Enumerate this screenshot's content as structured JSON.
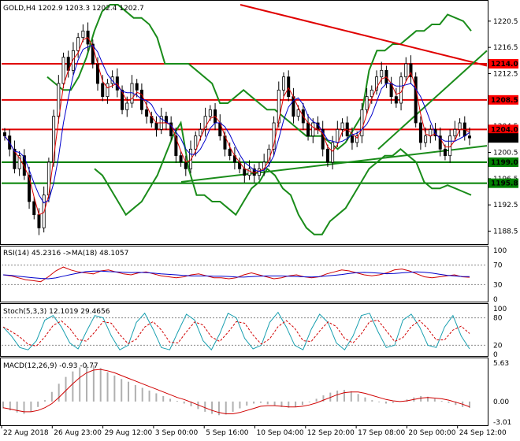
{
  "chart_data": [
    {
      "type": "candlestick",
      "title": "GOLD, H4",
      "ohlc_label": "GOLD,H4  1202.9 1203.3 1202.4 1202.7",
      "ylim": [
        1187,
        1223
      ],
      "y_ticks": [
        "1220.5",
        "1216.5",
        "1212.5",
        "1208.5",
        "1204.5",
        "1200.5",
        "1196.5",
        "1192.5",
        "1188.5"
      ],
      "x_labels": [
        "22 Aug 2018",
        "26 Aug 23:00",
        "29 Aug 12:00",
        "3 Sep 00:00",
        "5 Sep 16:00",
        "10 Sep 04:00",
        "12 Sep 20:00",
        "17 Sep 08:00",
        "20 Sep 00:00",
        "24 Sep 12:00"
      ],
      "price_tags": [
        {
          "label": "1214.0",
          "value": 1214.0,
          "color": "#ff0000"
        },
        {
          "label": "1208.5",
          "value": 1208.5,
          "color": "#ff0000"
        },
        {
          "label": "1204.0",
          "value": 1204.0,
          "color": "#ff0000"
        },
        {
          "label": "1202.7",
          "value": 1202.7,
          "color": "#000000"
        },
        {
          "label": "1199.0",
          "value": 1199.0,
          "color": "#008000"
        },
        {
          "label": "1195.8",
          "value": 1195.8,
          "color": "#008000"
        }
      ],
      "h_lines": [
        {
          "value": 1214.0,
          "color": "#e00000"
        },
        {
          "value": 1208.5,
          "color": "#e00000"
        },
        {
          "value": 1204.0,
          "color": "#e00000"
        },
        {
          "value": 1199.0,
          "color": "#008000"
        },
        {
          "value": 1195.8,
          "color": "#008000"
        }
      ],
      "close": [
        1203,
        1201,
        1198,
        1200,
        1197,
        1193,
        1191,
        1189,
        1194,
        1199,
        1206,
        1211,
        1215,
        1213,
        1216,
        1218,
        1219,
        1217,
        1214,
        1211,
        1209,
        1211,
        1212,
        1210,
        1207,
        1208,
        1211,
        1210,
        1207,
        1206,
        1205,
        1204,
        1206,
        1205,
        1203,
        1200,
        1199,
        1198,
        1201,
        1203,
        1204,
        1206,
        1207,
        1205,
        1203,
        1201,
        1200,
        1199,
        1198,
        1197,
        1198,
        1197,
        1198,
        1199,
        1201,
        1205,
        1210,
        1212,
        1209,
        1206,
        1207,
        1205,
        1203,
        1205,
        1204,
        1201,
        1199,
        1202,
        1204,
        1205,
        1203,
        1202,
        1203,
        1207,
        1209,
        1210,
        1212,
        1213,
        1211,
        1209,
        1208,
        1212,
        1214,
        1212,
        1205,
        1202,
        1203,
        1204,
        1203,
        1201,
        1200,
        1203,
        1204,
        1205,
        1203,
        1202.7
      ],
      "bb_upper": [
        1212,
        1211,
        1210,
        1210,
        1212,
        1215,
        1219,
        1222,
        1223,
        1223,
        1222,
        1221,
        1221,
        1220,
        1218,
        1214,
        1214,
        1214,
        1214,
        1213,
        1212,
        1211,
        1208,
        1208,
        1209,
        1210,
        1209,
        1208,
        1207,
        1207,
        1206,
        1205,
        1204,
        1203,
        1203,
        1203,
        1202,
        1201,
        1202,
        1204,
        1206,
        1213,
        1216,
        1216,
        1217,
        1217,
        1218,
        1219,
        1219,
        1220,
        1220,
        1221.5,
        1221,
        1220.5,
        1219
      ],
      "bb_lower": [
        1198,
        1197,
        1195,
        1193,
        1191,
        1192,
        1193,
        1195,
        1197,
        1200,
        1203,
        1205,
        1198,
        1194,
        1194,
        1193,
        1193,
        1192,
        1191,
        1193,
        1195,
        1196,
        1198,
        1197,
        1195,
        1194,
        1191,
        1189,
        1188,
        1188,
        1190,
        1191,
        1192,
        1194,
        1196,
        1198,
        1199,
        1200,
        1200,
        1201,
        1200,
        1199,
        1196,
        1195,
        1195,
        1195.5,
        1195,
        1194.5,
        1194
      ],
      "rsi": {
        "label": "RSI(14) 45.2316  ->MA(18) 48.1057",
        "ylim": [
          0,
          100
        ],
        "ticks": [
          "100",
          "70",
          "30",
          "0"
        ],
        "values": [
          50,
          48,
          44,
          40,
          38,
          36,
          46,
          58,
          66,
          60,
          56,
          54,
          52,
          58,
          60,
          56,
          52,
          50,
          54,
          56,
          52,
          48,
          46,
          44,
          46,
          50,
          52,
          48,
          44,
          44,
          42,
          44,
          50,
          54,
          50,
          46,
          42,
          44,
          48,
          50,
          46,
          44,
          46,
          52,
          56,
          60,
          58,
          54,
          50,
          48,
          50,
          54,
          60,
          62,
          58,
          52,
          46,
          44,
          46,
          48,
          50,
          46,
          45
        ]
      },
      "stoch": {
        "label": "Stoch(5,3,3) 12.1019 29.4656",
        "ylim": [
          0,
          100
        ],
        "ticks": [
          "100",
          "80",
          "20",
          "0"
        ],
        "values": [
          60,
          40,
          15,
          10,
          30,
          75,
          85,
          60,
          25,
          12,
          50,
          85,
          80,
          40,
          10,
          20,
          70,
          90,
          55,
          15,
          10,
          50,
          88,
          75,
          30,
          10,
          45,
          90,
          80,
          35,
          12,
          20,
          70,
          92,
          60,
          20,
          10,
          55,
          88,
          70,
          25,
          10,
          40,
          85,
          90,
          50,
          15,
          20,
          75,
          88,
          60,
          20,
          15,
          60,
          85,
          40,
          12
        ]
      },
      "macd": {
        "label": "MACD(12,26,9) -0.93 -0.77",
        "ylim": [
          -3.01,
          5.63
        ],
        "ticks": [
          "5.63",
          "0.00",
          "-3.01"
        ],
        "hist": [
          -1.0,
          -1.3,
          -1.6,
          -1.8,
          -1.5,
          -0.8,
          0.2,
          1.4,
          2.6,
          3.6,
          4.4,
          5.0,
          5.4,
          5.3,
          4.9,
          4.3,
          3.8,
          3.3,
          2.9,
          2.4,
          2.0,
          1.6,
          1.2,
          0.8,
          0.4,
          0.1,
          -0.3,
          -0.7,
          -1.1,
          -1.5,
          -1.8,
          -2.0,
          -1.9,
          -1.5,
          -1.0,
          -0.6,
          -0.3,
          -0.2,
          -0.4,
          -0.6,
          -0.8,
          -0.9,
          -0.8,
          -0.5,
          -0.1,
          0.4,
          0.9,
          1.3,
          1.6,
          1.7,
          1.5,
          1.1,
          0.6,
          0.2,
          -0.1,
          -0.3,
          -0.2,
          0.0,
          0.3,
          0.6,
          0.8,
          0.7,
          0.4,
          0.1,
          -0.2,
          -0.5,
          -0.8,
          -0.93
        ],
        "signal": [
          -0.9,
          -1.1,
          -1.3,
          -1.5,
          -1.5,
          -1.3,
          -0.9,
          -0.3,
          0.6,
          1.6,
          2.6,
          3.5,
          4.2,
          4.6,
          4.7,
          4.5,
          4.2,
          3.8,
          3.4,
          3.0,
          2.6,
          2.2,
          1.8,
          1.4,
          1.0,
          0.6,
          0.3,
          -0.1,
          -0.5,
          -0.9,
          -1.3,
          -1.6,
          -1.8,
          -1.8,
          -1.6,
          -1.3,
          -1.0,
          -0.7,
          -0.6,
          -0.6,
          -0.7,
          -0.8,
          -0.8,
          -0.7,
          -0.5,
          -0.2,
          0.2,
          0.6,
          1.0,
          1.3,
          1.4,
          1.4,
          1.2,
          0.9,
          0.6,
          0.3,
          0.1,
          0.0,
          0.1,
          0.3,
          0.5,
          0.6,
          0.5,
          0.4,
          0.2,
          -0.1,
          -0.4,
          -0.77
        ]
      }
    }
  ]
}
